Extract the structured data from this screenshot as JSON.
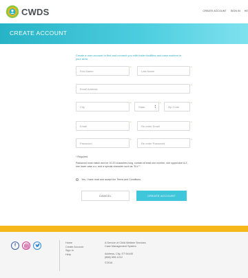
{
  "header": {
    "logo_text": "CWDS",
    "nav": [
      "CREATE ACCOUNT",
      "SIGN IN",
      "HE"
    ]
  },
  "banner": {
    "title": "CREATE ACCOUNT"
  },
  "form": {
    "intro": "Create a user account to find and connect you with foster facilities and case workers in your area.",
    "first_name_placeholder": "First Name",
    "last_name_placeholder": "Last Name",
    "email_placeholder": "Email Address",
    "city_placeholder": "City",
    "state_placeholder": "State",
    "zip_placeholder": "Zip Code",
    "email2_placeholder": "Email",
    "reenter_email_placeholder": "Re-enter Email",
    "password_placeholder": "Password",
    "reenter_password_placeholder": "Re-enter Password",
    "required_marker": "*",
    "required_note": "* Required",
    "password_note": "Password must match and be 10-20 characters long, contain at least one number, one uppercase A-Z, one lower case a-z, and a special character such as \"$ # *\".",
    "terms_label": "Yes, I have read and accept the Terms and Conditions.",
    "cancel_label": "CANCEL",
    "create_label": "CREATE ACCOUNT"
  },
  "footer": {
    "links": [
      "Home",
      "Create Account",
      "Sign In",
      "Help"
    ],
    "org_line1": "A Service of Child Welfare Services",
    "org_line2": "Case Management System",
    "address": "Address, City, ST 94445",
    "phone": "(888) 555-1212",
    "year": "©2016"
  },
  "colors": {
    "brand_teal": "#3fc6da",
    "accent_orange": "#e2892a",
    "footer_bar": "#f5b71a"
  }
}
